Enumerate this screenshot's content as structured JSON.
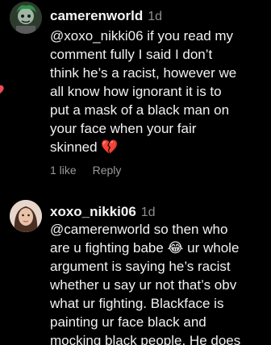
{
  "comments": [
    {
      "username": "camerenworld",
      "time": "1d",
      "lines": [
        "@xoxo_nikki06 if you read my",
        "comment fully I said I don’t",
        "think he’s a racist, however we",
        "all know how ignorant it is to",
        "put a mask of a black man on",
        "your face when your fair",
        "skinned 💔"
      ],
      "likes": "1 like",
      "reply": "Reply",
      "liked": true
    },
    {
      "username": "xoxo_nikki06",
      "time": "1d",
      "lines": [
        "@camerenworld so then who",
        "are u fighting babe 😂  ur whole",
        "argument is saying he’s racist",
        "whether u say ur not that’s obv",
        "what ur fighting. Blackface is",
        "painting ur face black and",
        "mocking black people. He does"
      ]
    }
  ],
  "colors": {
    "background": "#000000",
    "text": "#f2f2f2",
    "muted": "#8e8e8e",
    "like": "#ed4956"
  }
}
